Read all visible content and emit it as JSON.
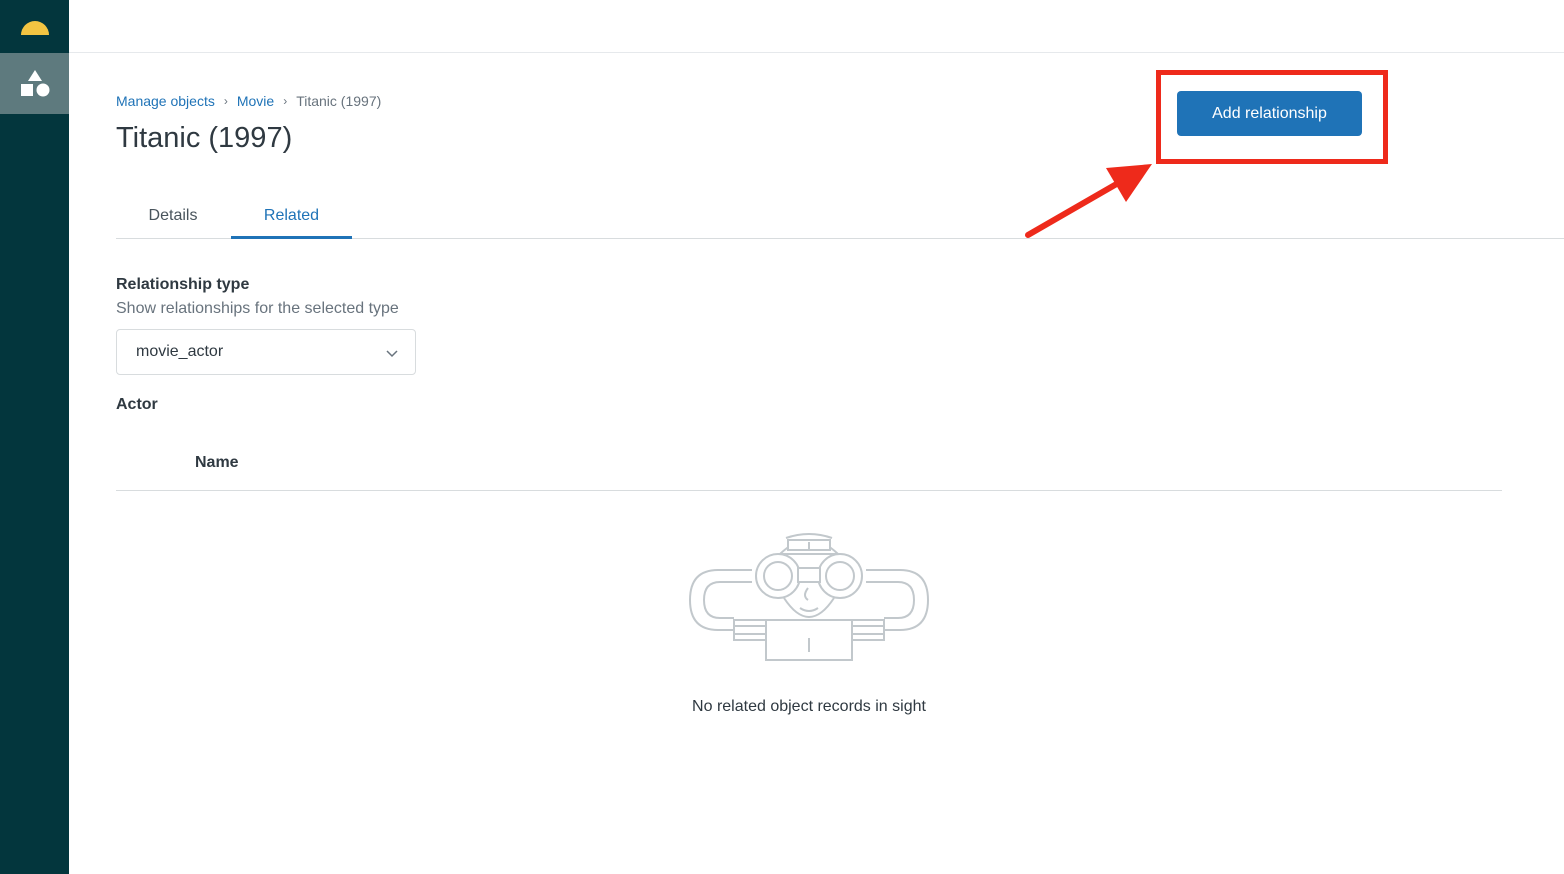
{
  "sidebar": {
    "logo_icon": "sun-half-icon",
    "objects_icon": "shapes-icon",
    "background": "#03363d",
    "active_background": "#5e7a7e"
  },
  "breadcrumb": {
    "items": [
      "Manage objects",
      "Movie"
    ],
    "current": "Titanic (1997)",
    "separator": "›"
  },
  "page": {
    "title": "Titanic (1997)"
  },
  "actions": {
    "add_relationship_label": "Add relationship",
    "primary_color": "#1f73b7",
    "highlight_color": "#ee2a1b"
  },
  "tabs": [
    {
      "label": "Details",
      "active": false
    },
    {
      "label": "Related",
      "active": true
    }
  ],
  "relationship": {
    "label": "Relationship type",
    "hint": "Show relationships for the selected type",
    "selected": "movie_actor"
  },
  "table": {
    "section_title": "Actor",
    "columns": [
      "Name"
    ]
  },
  "empty_state": {
    "illustration_icon": "sailor-binoculars-icon",
    "message": "No related object records in sight"
  }
}
